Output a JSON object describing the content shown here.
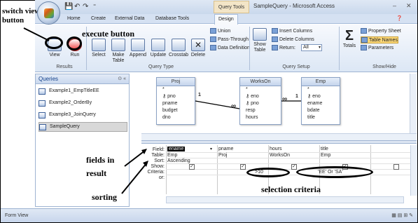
{
  "window": {
    "title": "SampleQuery - Microsoft Access",
    "context_tab": "Query Tools",
    "controls": {
      "minimize": "–",
      "close": "✕"
    }
  },
  "ribbon_tabs": [
    "Home",
    "Create",
    "External Data",
    "Database Tools",
    "Design"
  ],
  "ribbon": {
    "results": {
      "label": "Results",
      "view": "View",
      "run": "Run"
    },
    "query_type": {
      "label": "Query Type",
      "select": "Select",
      "make_table": "Make Table",
      "append": "Append",
      "update": "Update",
      "crosstab": "Crosstab",
      "delete": "Delete",
      "union": "Union",
      "pass_through": "Pass-Through",
      "data_definition": "Data Definition"
    },
    "query_setup": {
      "label": "Query Setup",
      "show_table": "Show Table",
      "insert_columns": "Insert Columns",
      "delete_columns": "Delete Columns",
      "return_label": "Return:",
      "return_value": "All"
    },
    "show_hide": {
      "label": "Show/Hide",
      "totals": "Totals",
      "property_sheet": "Property Sheet",
      "table_names": "Table Names",
      "parameters": "Parameters"
    }
  },
  "nav_pane": {
    "header": "Queries",
    "items": [
      "Example1_EmpTitleEE",
      "Example2_OrderBy",
      "Example3_JoinQuery",
      "SampleQuery"
    ],
    "selected": "SampleQuery"
  },
  "tables": [
    {
      "name": "Proj",
      "fields": [
        "*",
        "pno",
        "pname",
        "budget",
        "dno"
      ]
    },
    {
      "name": "WorksOn",
      "fields": [
        "*",
        "eno",
        "pno",
        "resp",
        "hours"
      ]
    },
    {
      "name": "Emp",
      "fields": [
        "*",
        "eno",
        "ename",
        "bdate",
        "title"
      ]
    }
  ],
  "relationships": {
    "one": "1",
    "many": "∞"
  },
  "grid": {
    "row_labels": [
      "Field:",
      "Table:",
      "Sort:",
      "Show:",
      "Criteria:",
      "or:"
    ],
    "columns": [
      {
        "field": "ename",
        "table": "Emp",
        "sort": "Ascending",
        "show": true,
        "criteria": ""
      },
      {
        "field": "pname",
        "table": "Proj",
        "sort": "",
        "show": true,
        "criteria": ""
      },
      {
        "field": "hours",
        "table": "WorksOn",
        "sort": "",
        "show": true,
        "criteria": ">10"
      },
      {
        "field": "title",
        "table": "Emp",
        "sort": "",
        "show": true,
        "criteria": "'EE' Or 'SA'"
      },
      {
        "field": "",
        "table": "",
        "sort": "",
        "show": false,
        "criteria": ""
      }
    ]
  },
  "status": {
    "text": "Form View"
  },
  "annotations": {
    "switch_view": "switch view button",
    "switch_view_line1": "switch view",
    "switch_view_line2": "button",
    "execute": "execute button",
    "fields_in_result_line1": "fields in",
    "fields_in_result_line2": "result",
    "sorting": "sorting",
    "selection_criteria": "selection criteria"
  },
  "colors": {
    "ribbon": "#dce7f5",
    "accent": "#15428b",
    "annotation": "#000000"
  }
}
